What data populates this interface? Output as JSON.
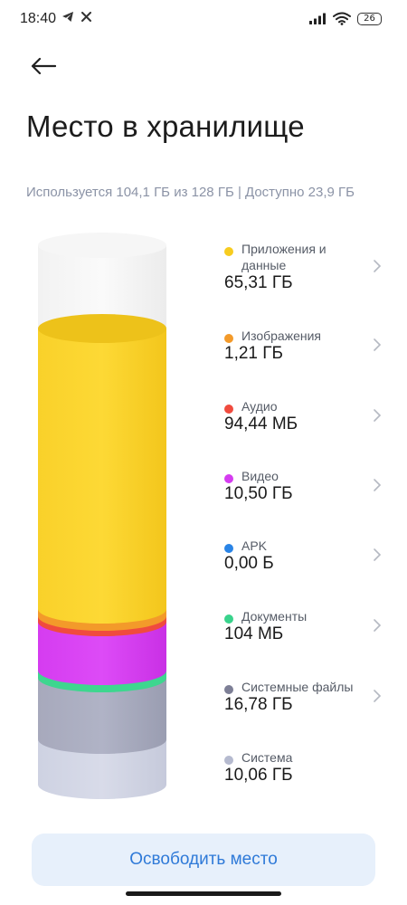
{
  "status_bar": {
    "time": "18:40",
    "left_icons": [
      "telegram-icon",
      "close-icon"
    ],
    "right_icons": [
      "signal-icon",
      "wifi-icon",
      "battery-icon"
    ],
    "battery_level": "26"
  },
  "header": {
    "back_icon": "arrow-left-icon",
    "title": "Место в хранилище"
  },
  "summary": {
    "text": "Используется 104,1 ГБ из 128 ГБ | Доступно 23,9 ГБ"
  },
  "categories": [
    {
      "label": "Приложения и данные",
      "value": "65,31 ГБ",
      "color": "#F7CC1F"
    },
    {
      "label": "Изображения",
      "value": "1,21 ГБ",
      "color": "#F39A2A"
    },
    {
      "label": "Аудио",
      "value": "94,44 МБ",
      "color": "#F04B3E"
    },
    {
      "label": "Видео",
      "value": "10,50 ГБ",
      "color": "#D53CF0"
    },
    {
      "label": "APK",
      "value": "0,00 Б",
      "color": "#2A84E6"
    },
    {
      "label": "Документы",
      "value": "104 МБ",
      "color": "#39D38C"
    },
    {
      "label": "Системные файлы",
      "value": "16,78 ГБ",
      "color": "#7D7F96"
    },
    {
      "label": "Система",
      "value": "10,06 ГБ",
      "color": "#B5BACF"
    }
  ],
  "actions": {
    "free_space_label": "Освободить место"
  }
}
